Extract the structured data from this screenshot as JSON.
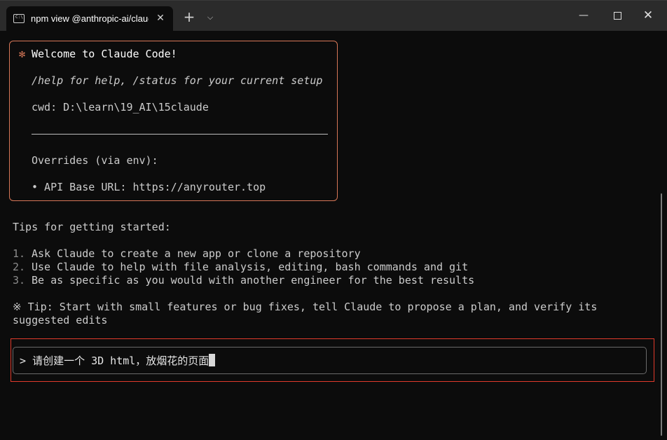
{
  "window": {
    "tab_title": "npm view @anthropic-ai/claude",
    "tab_close_glyph": "✕",
    "new_tab_glyph": "+",
    "dropdown_glyph": "⌵",
    "minimize_glyph": "—",
    "close_glyph": "✕"
  },
  "welcome": {
    "asterisk": "✻",
    "title": "Welcome to Claude Code!",
    "help_line": "/help for help, /status for your current setup",
    "cwd": "cwd: D:\\learn\\19_AI\\15claude",
    "overrides_title": "Overrides (via env):",
    "api_base": "• API Base URL: https://anyrouter.top"
  },
  "tips": {
    "heading": "Tips for getting started:",
    "items": [
      {
        "num": "1.",
        "text": "Ask Claude to create a new app or clone a repository"
      },
      {
        "num": "2.",
        "text": "Use Claude to help with file analysis, editing, bash commands and git"
      },
      {
        "num": "3.",
        "text": "Be as specific as you would with another engineer for the best results"
      }
    ],
    "tip_line1": "※ Tip: Start with small features or bug fixes, tell Claude to propose a plan, and verify its",
    "tip_line2": "suggested edits"
  },
  "prompt": {
    "symbol": ">",
    "value": "请创建一个 3D html，放烟花的页面"
  },
  "colors": {
    "accent": "#d77757",
    "highlight": "#e03a2b",
    "background": "#0c0c0c",
    "titlebar": "#2b2b2b"
  },
  "icons": [
    "terminal-icon",
    "close-icon",
    "plus-icon",
    "chevron-down-icon",
    "minimize-icon",
    "maximize-icon",
    "close-window-icon"
  ]
}
